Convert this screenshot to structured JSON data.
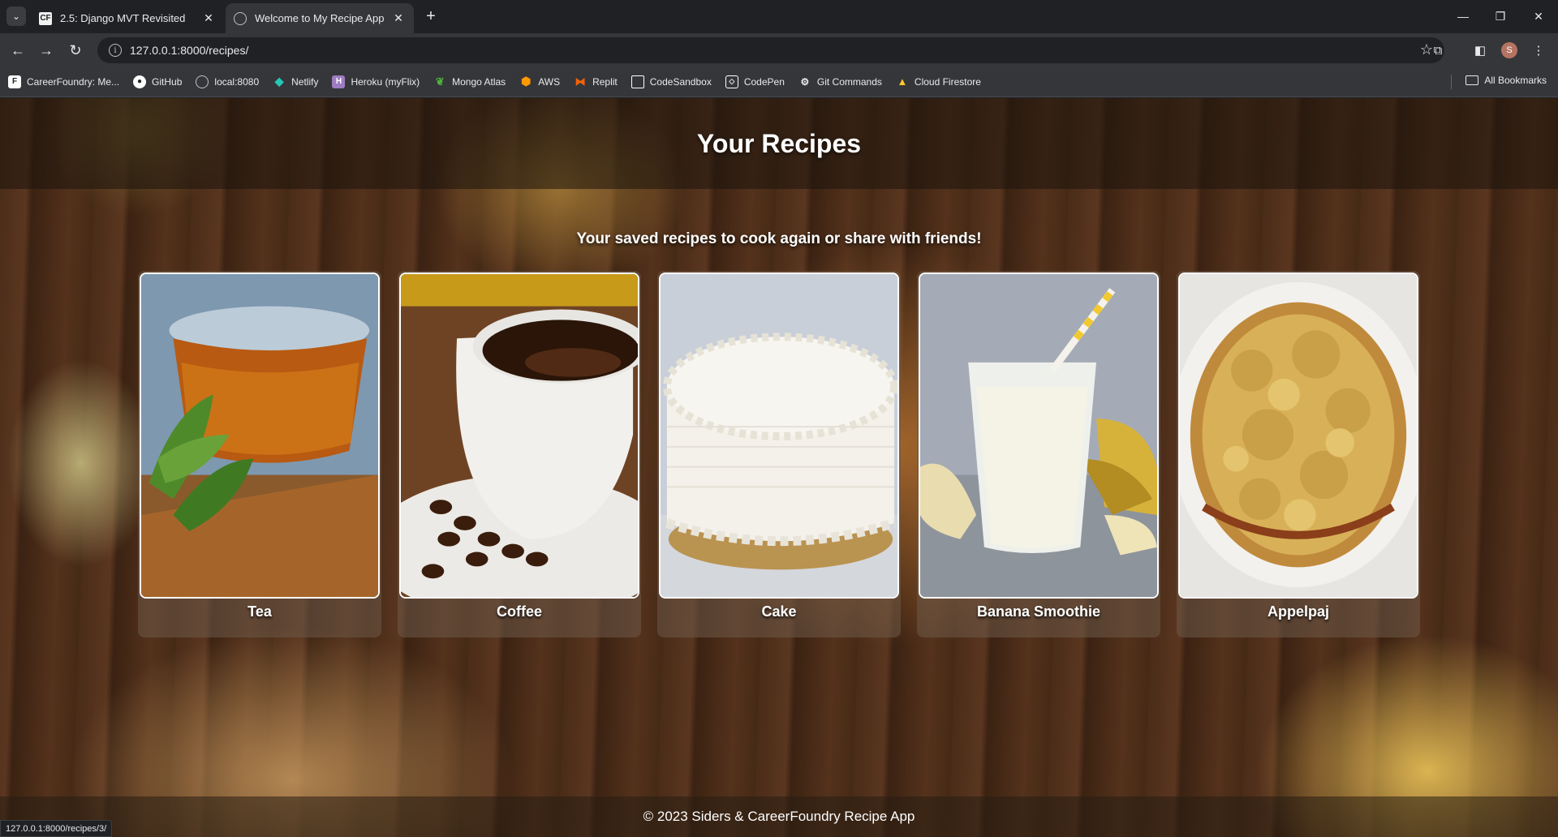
{
  "browser": {
    "tabs": [
      {
        "title": "2.5: Django MVT Revisited",
        "active": false,
        "icon": "careerfoundry-favicon"
      },
      {
        "title": "Welcome to My Recipe App",
        "active": true,
        "icon": "globe-icon"
      }
    ],
    "address": "127.0.0.1:8000/recipes/",
    "bookmarks": [
      {
        "label": "CareerFoundry: Me...",
        "icon": "careerfoundry-icon",
        "color": "#ffffff"
      },
      {
        "label": "GitHub",
        "icon": "github-icon",
        "color": "#ffffff"
      },
      {
        "label": "local:8080",
        "icon": "globe-icon",
        "color": "#bdc1c6"
      },
      {
        "label": "Netlify",
        "icon": "netlify-icon",
        "color": "#25c7b7"
      },
      {
        "label": "Heroku (myFlix)",
        "icon": "heroku-icon",
        "color": "#9e7cc1"
      },
      {
        "label": "Mongo Atlas",
        "icon": "mongo-icon",
        "color": "#4db33d"
      },
      {
        "label": "AWS",
        "icon": "aws-icon",
        "color": "#f90"
      },
      {
        "label": "Replit",
        "icon": "replit-icon",
        "color": "#f26207"
      },
      {
        "label": "CodeSandbox",
        "icon": "codesandbox-icon",
        "color": "#ffffff"
      },
      {
        "label": "CodePen",
        "icon": "codepen-icon",
        "color": "#ffffff"
      },
      {
        "label": "Git Commands",
        "icon": "gear-icon",
        "color": "#ffffff"
      },
      {
        "label": "Cloud Firestore",
        "icon": "firebase-icon",
        "color": "#ffca28"
      }
    ],
    "all_bookmarks": "All Bookmarks",
    "status_url": "127.0.0.1:8000/recipes/3/"
  },
  "page": {
    "header": "Your Recipes",
    "subtitle": "Your saved recipes to cook again or share with friends!",
    "recipes": [
      {
        "name": "Tea",
        "image": "tea-glass-with-mint"
      },
      {
        "name": "Coffee",
        "image": "coffee-cup-with-beans"
      },
      {
        "name": "Cake",
        "image": "white-frosted-cake"
      },
      {
        "name": "Banana Smoothie",
        "image": "banana-smoothie-glass"
      },
      {
        "name": "Appelpaj",
        "image": "apple-crumble-pie"
      }
    ],
    "footer": "© 2023 Siders & CareerFoundry Recipe App"
  }
}
